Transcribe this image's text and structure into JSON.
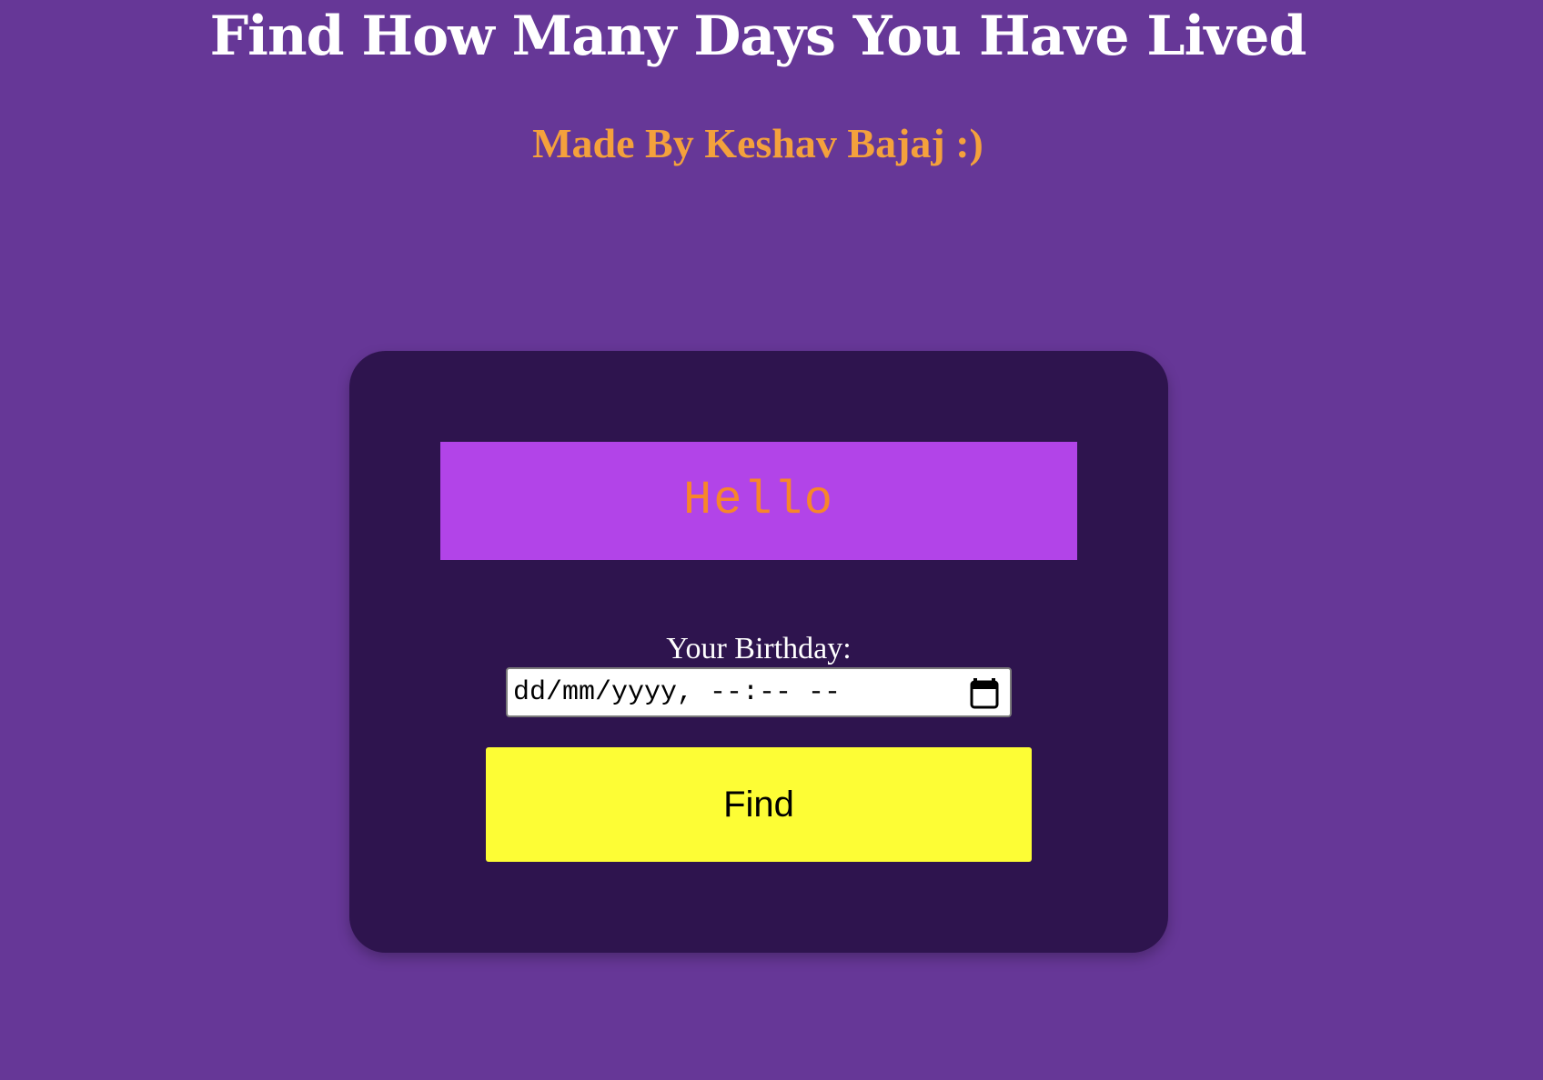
{
  "header": {
    "title": "Find How Many Days You Have Lived",
    "subtitle": "Made By Keshav Bajaj :)"
  },
  "card": {
    "greeting": "Hello",
    "birthday_label": "Your Birthday:",
    "birthday_input": {
      "placeholder": "dd/mm/yyyy, --:-- --",
      "value": "",
      "icon": "calendar-icon"
    },
    "find_label": "Find"
  },
  "colors": {
    "page_background": "#663797",
    "card_background": "#2e144e",
    "greeting_background": "#b244e8",
    "greeting_text": "#f7862a",
    "subtitle_text": "#f4a13c",
    "find_button": "#fdfd35"
  }
}
